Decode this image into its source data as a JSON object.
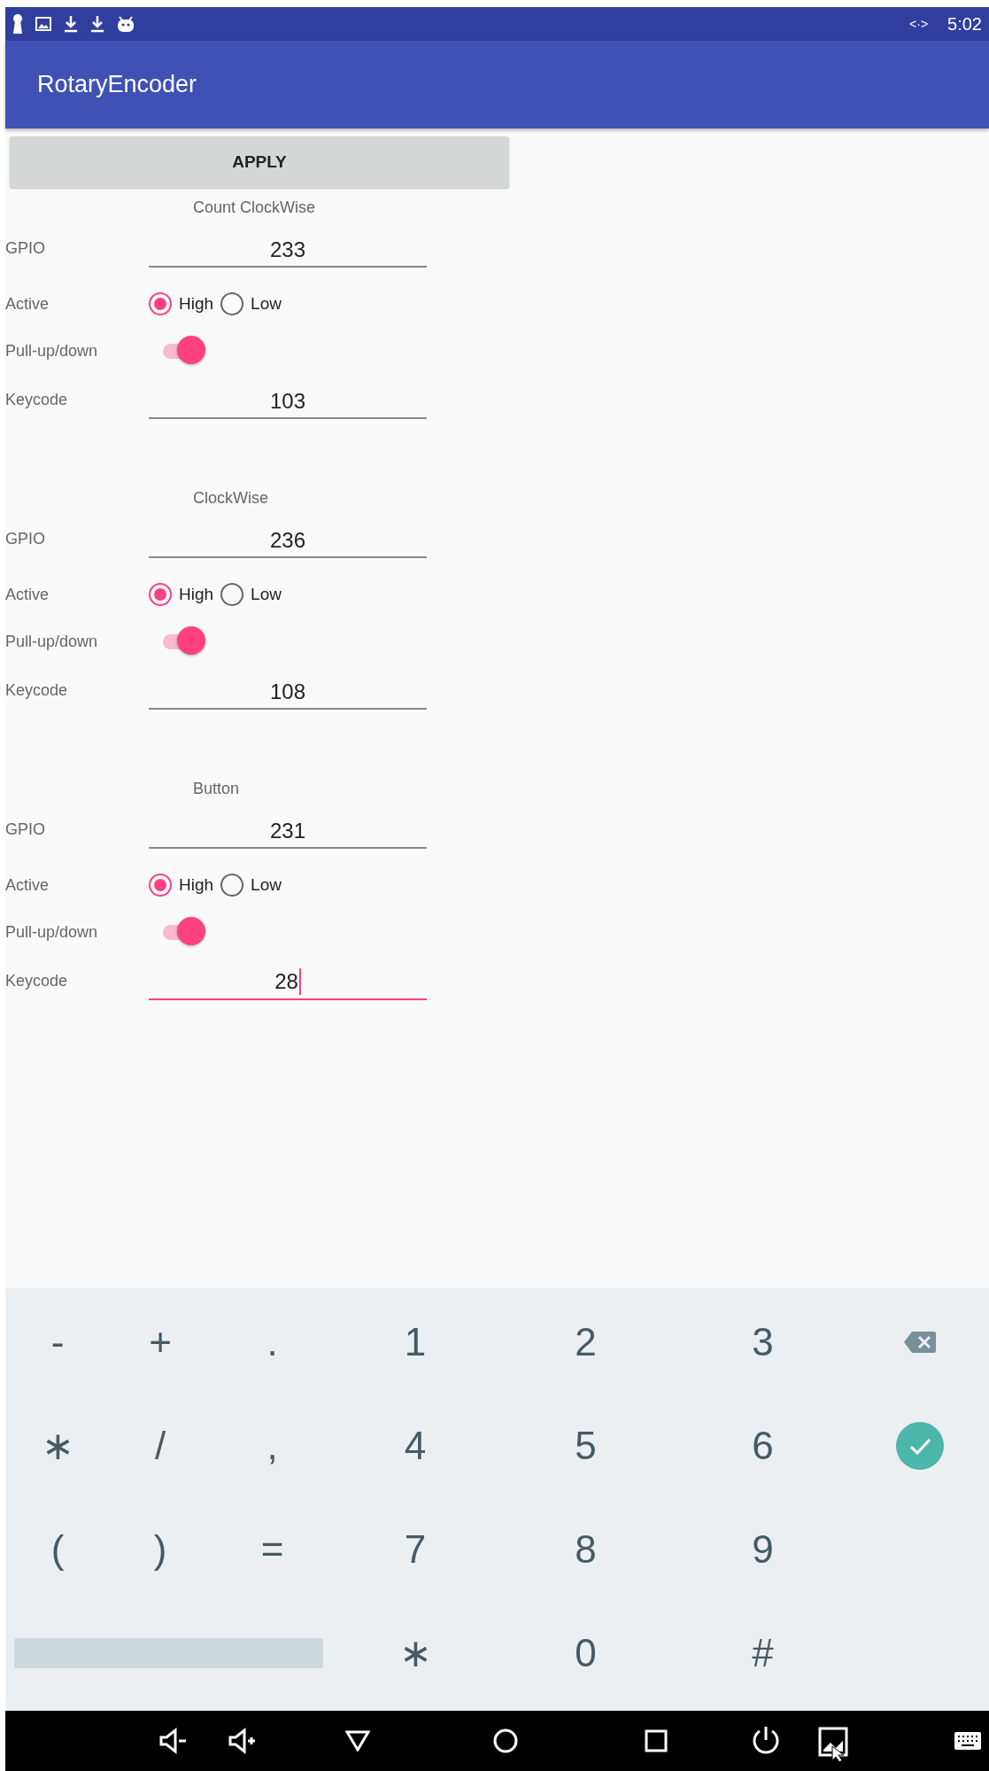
{
  "status_bar": {
    "time": "5:02",
    "connection_symbol": "<·>"
  },
  "app_bar": {
    "title": "RotaryEncoder"
  },
  "apply_button": "APPLY",
  "sections": [
    {
      "title": "Count ClockWise",
      "gpio": {
        "label": "GPIO",
        "value": "233",
        "focused": false
      },
      "active": {
        "label": "Active",
        "options": [
          {
            "label": "High",
            "selected": true
          },
          {
            "label": "Low",
            "selected": false
          }
        ]
      },
      "pull": {
        "label": "Pull-up/down",
        "on": true
      },
      "keycode": {
        "label": "Keycode",
        "value": "103",
        "focused": false
      }
    },
    {
      "title": "ClockWise",
      "gpio": {
        "label": "GPIO",
        "value": "236",
        "focused": false
      },
      "active": {
        "label": "Active",
        "options": [
          {
            "label": "High",
            "selected": true
          },
          {
            "label": "Low",
            "selected": false
          }
        ]
      },
      "pull": {
        "label": "Pull-up/down",
        "on": true
      },
      "keycode": {
        "label": "Keycode",
        "value": "108",
        "focused": false
      }
    },
    {
      "title": "Button",
      "gpio": {
        "label": "GPIO",
        "value": "231",
        "focused": false
      },
      "active": {
        "label": "Active",
        "options": [
          {
            "label": "High",
            "selected": true
          },
          {
            "label": "Low",
            "selected": false
          }
        ]
      },
      "pull": {
        "label": "Pull-up/down",
        "on": true
      },
      "keycode": {
        "label": "Keycode",
        "value": "28",
        "focused": true
      }
    }
  ],
  "keyboard": {
    "rows": [
      [
        {
          "kind": "char",
          "label": "-"
        },
        {
          "kind": "char",
          "label": "+"
        },
        {
          "kind": "char",
          "label": "."
        },
        {
          "kind": "char",
          "label": "1"
        },
        {
          "kind": "char",
          "label": "2"
        },
        {
          "kind": "char",
          "label": "3"
        },
        {
          "kind": "backspace"
        }
      ],
      [
        {
          "kind": "char",
          "label": "∗"
        },
        {
          "kind": "char",
          "label": "/"
        },
        {
          "kind": "char",
          "label": ","
        },
        {
          "kind": "char",
          "label": "4"
        },
        {
          "kind": "char",
          "label": "5"
        },
        {
          "kind": "char",
          "label": "6"
        },
        {
          "kind": "done"
        }
      ],
      [
        {
          "kind": "char",
          "label": "("
        },
        {
          "kind": "char",
          "label": ")"
        },
        {
          "kind": "char",
          "label": "="
        },
        {
          "kind": "char",
          "label": "7"
        },
        {
          "kind": "char",
          "label": "8"
        },
        {
          "kind": "char",
          "label": "9"
        },
        {
          "kind": "empty"
        }
      ],
      [
        {
          "kind": "space"
        },
        {
          "kind": "space"
        },
        {
          "kind": "space"
        },
        {
          "kind": "char",
          "label": "∗"
        },
        {
          "kind": "char",
          "label": "0"
        },
        {
          "kind": "char",
          "label": "#"
        },
        {
          "kind": "empty"
        }
      ]
    ]
  }
}
